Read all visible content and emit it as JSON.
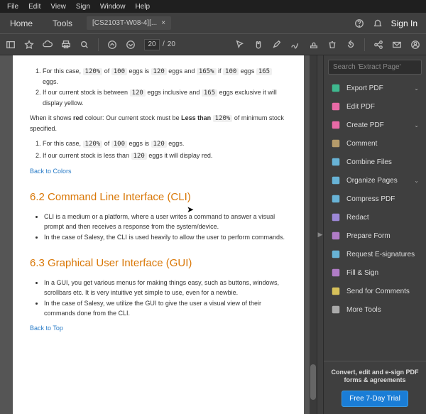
{
  "menu": {
    "items": [
      "File",
      "Edit",
      "View",
      "Sign",
      "Window",
      "Help"
    ]
  },
  "topbar": {
    "home": "Home",
    "tools": "Tools",
    "tab_title": "[CS2103T-W08-4][...",
    "signin": "Sign In"
  },
  "toolbar": {
    "page_current": "20",
    "page_total": "20"
  },
  "rpanel": {
    "search_placeholder": "Search 'Extract Page'",
    "items": [
      {
        "label": "Export PDF",
        "color": "#3fb98f",
        "chev": true
      },
      {
        "label": "Edit PDF",
        "color": "#e86aa6",
        "chev": false
      },
      {
        "label": "Create PDF",
        "color": "#e86aa6",
        "chev": true
      },
      {
        "label": "Comment",
        "color": "#b59b6b",
        "chev": false
      },
      {
        "label": "Combine Files",
        "color": "#68b3d6",
        "chev": false
      },
      {
        "label": "Organize Pages",
        "color": "#68b3d6",
        "chev": true
      },
      {
        "label": "Compress PDF",
        "color": "#68b3d6",
        "chev": false
      },
      {
        "label": "Redact",
        "color": "#9c87d6",
        "chev": false
      },
      {
        "label": "Prepare Form",
        "color": "#b07cc6",
        "chev": false
      },
      {
        "label": "Request E-signatures",
        "color": "#68b3d6",
        "chev": false
      },
      {
        "label": "Fill & Sign",
        "color": "#b07cc6",
        "chev": false
      },
      {
        "label": "Send for Comments",
        "color": "#d6c05a",
        "chev": false
      },
      {
        "label": "More Tools",
        "color": "#aaa",
        "chev": false
      }
    ],
    "promo_text": "Convert, edit and e-sign PDF forms & agreements",
    "promo_btn": "Free 7-Day Trial"
  },
  "doc": {
    "li1_a": "For this case, ",
    "li1_b": " of ",
    "li1_c": " eggs is ",
    "li1_d": " eggs and ",
    "li1_e": " if ",
    "li1_f": " eggs ",
    "li1_g": " eggs.",
    "c120p": "120%",
    "c100": "100",
    "c120": "120",
    "c165p": "165%",
    "c165": "165",
    "li2_a": "If our current stock is between ",
    "li2_b": " eggs inclusive and ",
    "li2_c": " eggs exclusive it will display yellow.",
    "p1_a": "When it shows ",
    "p1_red": "red",
    "p1_b": " colour: Our current stock must be ",
    "p1_bold": "Less than ",
    "p1_c": " of minimum stock specified.",
    "li3_a": "For this case, ",
    "li3_b": " of ",
    "li3_c": " eggs is ",
    "li3_d": " eggs.",
    "li4_a": "If our current stock is less than ",
    "li4_b": " eggs it will display red.",
    "back_colors": "Back to Colors",
    "h62": "6.2 Command Line Interface (CLI)",
    "cli1": "CLI is a medium or a platform, where a user writes a command to answer a visual prompt and then receives a response from the system/device.",
    "cli2": "In the case of Salesy, the CLI is used heavily to allow the user to perform commands.",
    "h63": "6.3 Graphical User Interface (GUI)",
    "gui1": "In a GUI, you get various menus for making things easy, such as buttons, windows, scrollbars etc. It is very intuitive yet simple to use, even for a newbie.",
    "gui2": "In the case of Salesy, we utilize the GUI to give the user a visual view of their commands done from the CLI.",
    "back_top": "Back to Top"
  }
}
